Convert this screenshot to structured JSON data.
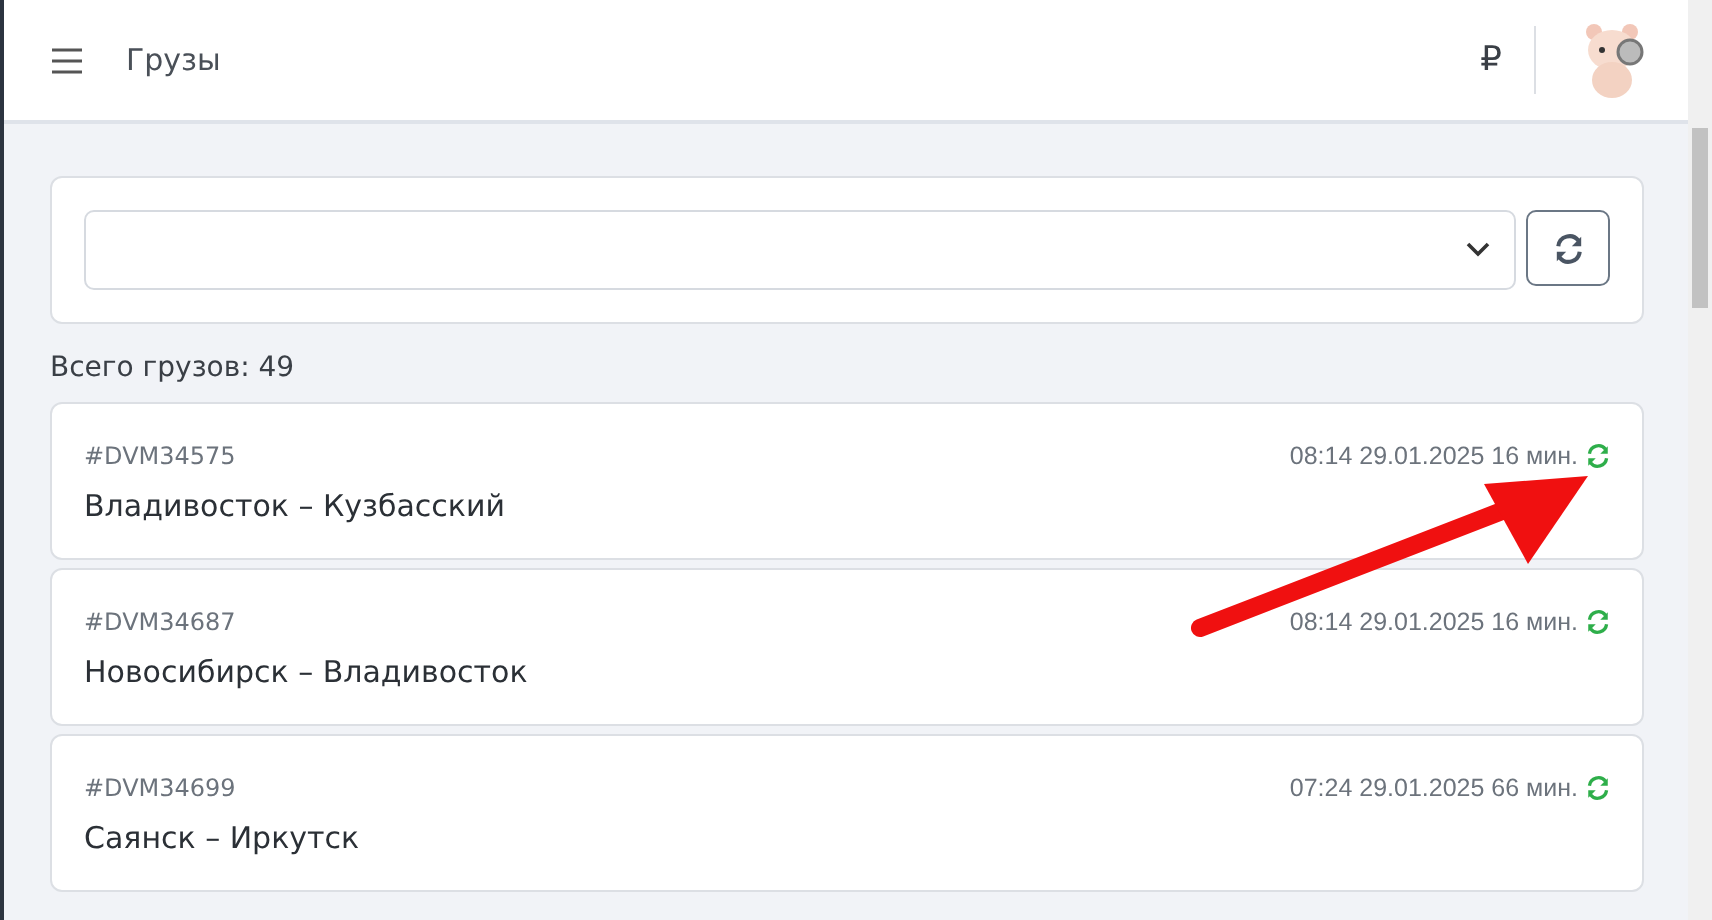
{
  "header": {
    "title": "Грузы",
    "currency": "₽"
  },
  "total": "Всего грузов: 49",
  "cargos": [
    {
      "id": "#DVM34575",
      "route": "Владивосток – Кузбасский",
      "time": "08:14 29.01.2025 16 мин."
    },
    {
      "id": "#DVM34687",
      "route": "Новосибирск – Владивосток",
      "time": "08:14 29.01.2025 16 мин."
    },
    {
      "id": "#DVM34699",
      "route": "Саянск – Иркутск",
      "time": "07:24 29.01.2025 66 мин."
    }
  ]
}
